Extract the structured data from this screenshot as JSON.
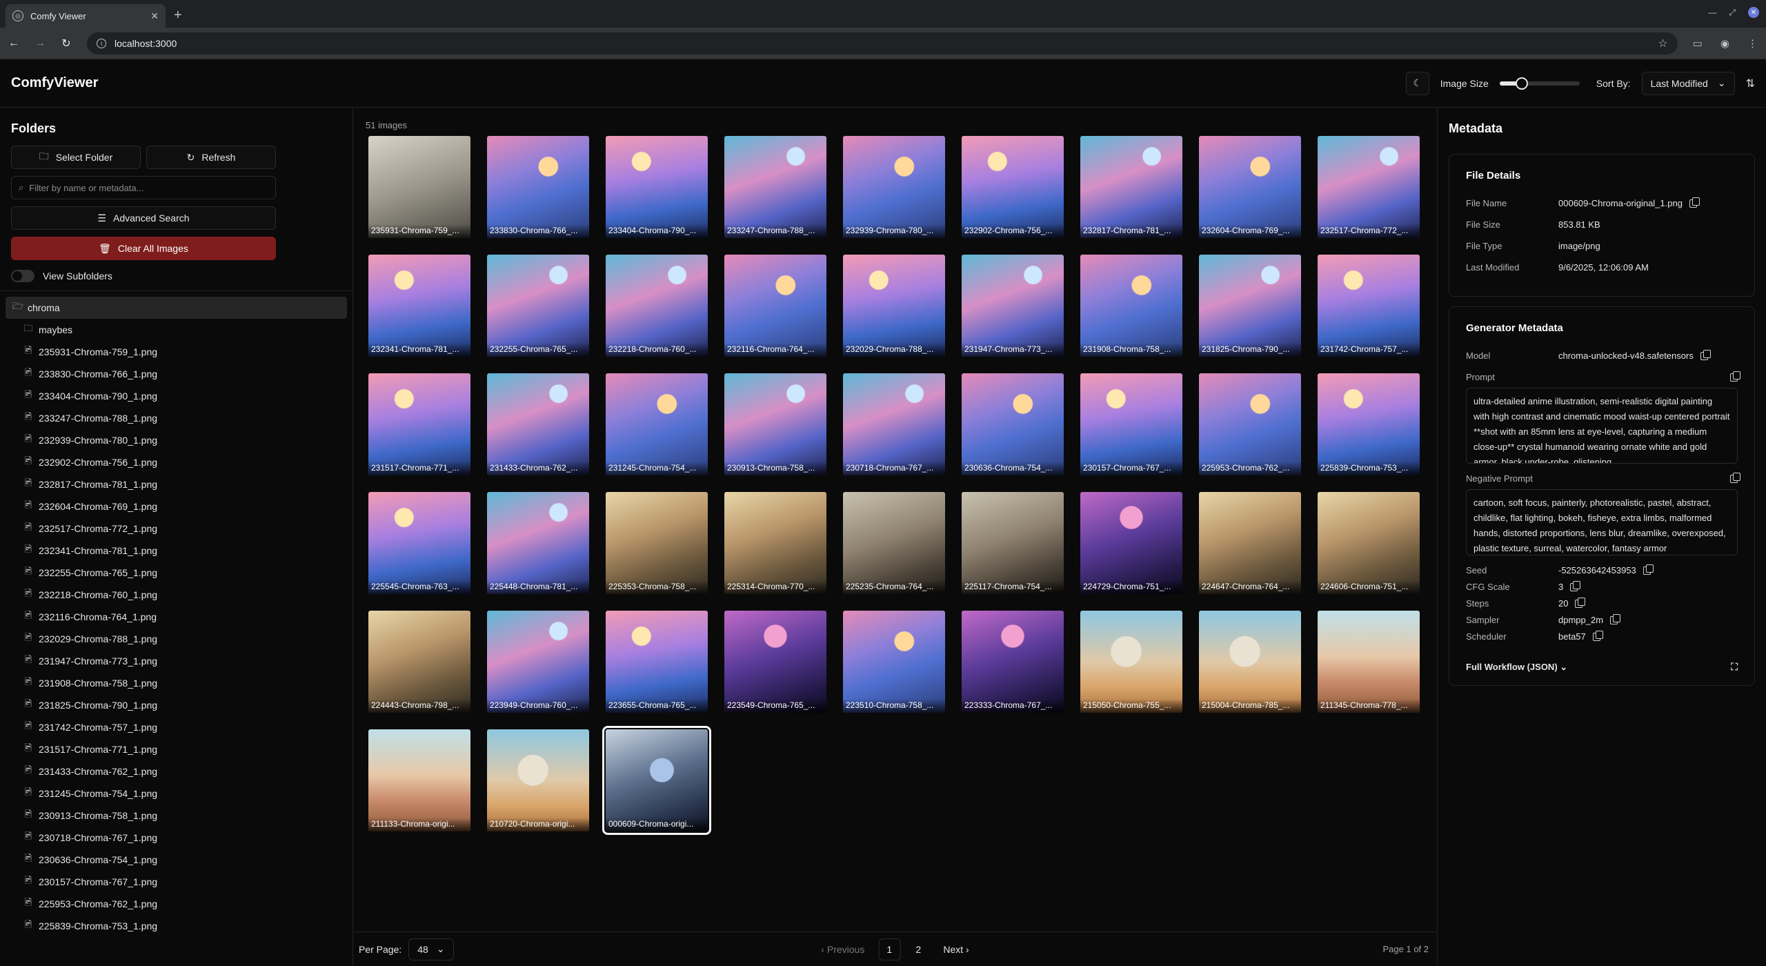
{
  "browser": {
    "tab_title": "Comfy Viewer",
    "url": "localhost:3000"
  },
  "header": {
    "brand": "ComfyViewer",
    "image_size_label": "Image Size",
    "image_size_level": 0.28,
    "sort_label": "Sort By:",
    "sort_value": "Last Modified"
  },
  "sidebar": {
    "title": "Folders",
    "select_folder": "Select Folder",
    "refresh": "Refresh",
    "filter_placeholder": "Filter by name or metadata...",
    "advanced_search": "Advanced Search",
    "clear_all": "Clear All Images",
    "view_subfolders": "View Subfolders",
    "root_folder": "chroma",
    "subfolder": "maybes",
    "files": [
      "235931-Chroma-759_1.png",
      "233830-Chroma-766_1.png",
      "233404-Chroma-790_1.png",
      "233247-Chroma-788_1.png",
      "232939-Chroma-780_1.png",
      "232902-Chroma-756_1.png",
      "232817-Chroma-781_1.png",
      "232604-Chroma-769_1.png",
      "232517-Chroma-772_1.png",
      "232341-Chroma-781_1.png",
      "232255-Chroma-765_1.png",
      "232218-Chroma-760_1.png",
      "232116-Chroma-764_1.png",
      "232029-Chroma-788_1.png",
      "231947-Chroma-773_1.png",
      "231908-Chroma-758_1.png",
      "231825-Chroma-790_1.png",
      "231742-Chroma-757_1.png",
      "231517-Chroma-771_1.png",
      "231433-Chroma-762_1.png",
      "231245-Chroma-754_1.png",
      "230913-Chroma-758_1.png",
      "230718-Chroma-767_1.png",
      "230636-Chroma-754_1.png",
      "230157-Chroma-767_1.png",
      "225953-Chroma-762_1.png",
      "225839-Chroma-753_1.png"
    ]
  },
  "gallery": {
    "count": "51 images",
    "images": [
      {
        "caption": "235931-Chroma-759_...",
        "style": "t-sketch"
      },
      {
        "caption": "233830-Chroma-766_...",
        "style": "t-knight"
      },
      {
        "caption": "233404-Chroma-790_...",
        "style": "t-knight2"
      },
      {
        "caption": "233247-Chroma-788_...",
        "style": "t-knight3"
      },
      {
        "caption": "232939-Chroma-780_...",
        "style": "t-knight"
      },
      {
        "caption": "232902-Chroma-756_...",
        "style": "t-knight2"
      },
      {
        "caption": "232817-Chroma-781_...",
        "style": "t-knight3"
      },
      {
        "caption": "232604-Chroma-769_...",
        "style": "t-knight"
      },
      {
        "caption": "232517-Chroma-772_...",
        "style": "t-knight3"
      },
      {
        "caption": "232341-Chroma-781_...",
        "style": "t-knight2"
      },
      {
        "caption": "232255-Chroma-765_...",
        "style": "t-knight3"
      },
      {
        "caption": "232218-Chroma-760_...",
        "style": "t-knight3"
      },
      {
        "caption": "232116-Chroma-764_...",
        "style": "t-knight"
      },
      {
        "caption": "232029-Chroma-788_...",
        "style": "t-knight2"
      },
      {
        "caption": "231947-Chroma-773_...",
        "style": "t-knight3"
      },
      {
        "caption": "231908-Chroma-758_...",
        "style": "t-knight"
      },
      {
        "caption": "231825-Chroma-790_...",
        "style": "t-knight3"
      },
      {
        "caption": "231742-Chroma-757_...",
        "style": "t-knight2"
      },
      {
        "caption": "231517-Chroma-771_...",
        "style": "t-knight2"
      },
      {
        "caption": "231433-Chroma-762_...",
        "style": "t-knight3"
      },
      {
        "caption": "231245-Chroma-754_...",
        "style": "t-knight"
      },
      {
        "caption": "230913-Chroma-758_...",
        "style": "t-knight3"
      },
      {
        "caption": "230718-Chroma-767_...",
        "style": "t-knight3"
      },
      {
        "caption": "230636-Chroma-754_...",
        "style": "t-knight"
      },
      {
        "caption": "230157-Chroma-767_...",
        "style": "t-knight2"
      },
      {
        "caption": "225953-Chroma-762_...",
        "style": "t-knight"
      },
      {
        "caption": "225839-Chroma-753_...",
        "style": "t-knight2"
      },
      {
        "caption": "225545-Chroma-763_...",
        "style": "t-knight2"
      },
      {
        "caption": "225448-Chroma-781_...",
        "style": "t-knight3"
      },
      {
        "caption": "225353-Chroma-758_...",
        "style": "t-angel"
      },
      {
        "caption": "225314-Chroma-770_...",
        "style": "t-angel"
      },
      {
        "caption": "225235-Chroma-764_...",
        "style": "t-angel2"
      },
      {
        "caption": "225117-Chroma-754_...",
        "style": "t-angel2"
      },
      {
        "caption": "224729-Chroma-751_...",
        "style": "t-dark"
      },
      {
        "caption": "224647-Chroma-764_...",
        "style": "t-angel"
      },
      {
        "caption": "224606-Chroma-751_...",
        "style": "t-angel"
      },
      {
        "caption": "224443-Chroma-798_...",
        "style": "t-angel"
      },
      {
        "caption": "223949-Chroma-760_...",
        "style": "t-knight3"
      },
      {
        "caption": "223655-Chroma-765_...",
        "style": "t-knight2"
      },
      {
        "caption": "223549-Chroma-765_...",
        "style": "t-dark"
      },
      {
        "caption": "223510-Chroma-758_...",
        "style": "t-knight"
      },
      {
        "caption": "223333-Chroma-767_...",
        "style": "t-dark"
      },
      {
        "caption": "215050-Chroma-755_...",
        "style": "t-desert"
      },
      {
        "caption": "215004-Chroma-785_...",
        "style": "t-desert"
      },
      {
        "caption": "211345-Chroma-778_...",
        "style": "t-desert2"
      },
      {
        "caption": "211133-Chroma-origi...",
        "style": "t-desert2"
      },
      {
        "caption": "210720-Chroma-origi...",
        "style": "t-desert"
      },
      {
        "caption": "000609-Chroma-origi...",
        "style": "t-last",
        "selected": true
      }
    ]
  },
  "pager": {
    "per_page_label": "Per Page:",
    "per_page_value": "48",
    "previous": "Previous",
    "page1": "1",
    "page2": "2",
    "next": "Next",
    "page_of": "Page 1 of 2"
  },
  "meta": {
    "title": "Metadata",
    "file_details_title": "File Details",
    "file_name_label": "File Name",
    "file_name": "000609-Chroma-original_1.png",
    "file_size_label": "File Size",
    "file_size": "853.81 KB",
    "file_type_label": "File Type",
    "file_type": "image/png",
    "last_modified_label": "Last Modified",
    "last_modified": "9/6/2025, 12:06:09 AM",
    "generator_title": "Generator Metadata",
    "model_label": "Model",
    "model": "chroma-unlocked-v48.safetensors",
    "prompt_label": "Prompt",
    "prompt": "ultra-detailed anime illustration, semi-realistic digital painting with high contrast and cinematic mood waist-up centered portrait **shot with an 85mm lens at eye-level, capturing a medium close-up** crystal humanoid wearing ornate white and gold armor, black under-robe, glistening",
    "negative_label": "Negative Prompt",
    "negative": "cartoon, soft focus, painterly, photorealistic, pastel, abstract, childlike, flat lighting, bokeh, fisheye, extra limbs, malformed hands, distorted proportions, lens blur, dreamlike, overexposed, plastic texture, surreal, watercolor, fantasy armor",
    "seed_label": "Seed",
    "seed": "-525263642453953",
    "cfg_label": "CFG Scale",
    "cfg": "3",
    "steps_label": "Steps",
    "steps": "20",
    "sampler_label": "Sampler",
    "sampler": "dpmpp_2m",
    "scheduler_label": "Scheduler",
    "scheduler": "beta57",
    "workflow_label": "Full Workflow (JSON)"
  }
}
